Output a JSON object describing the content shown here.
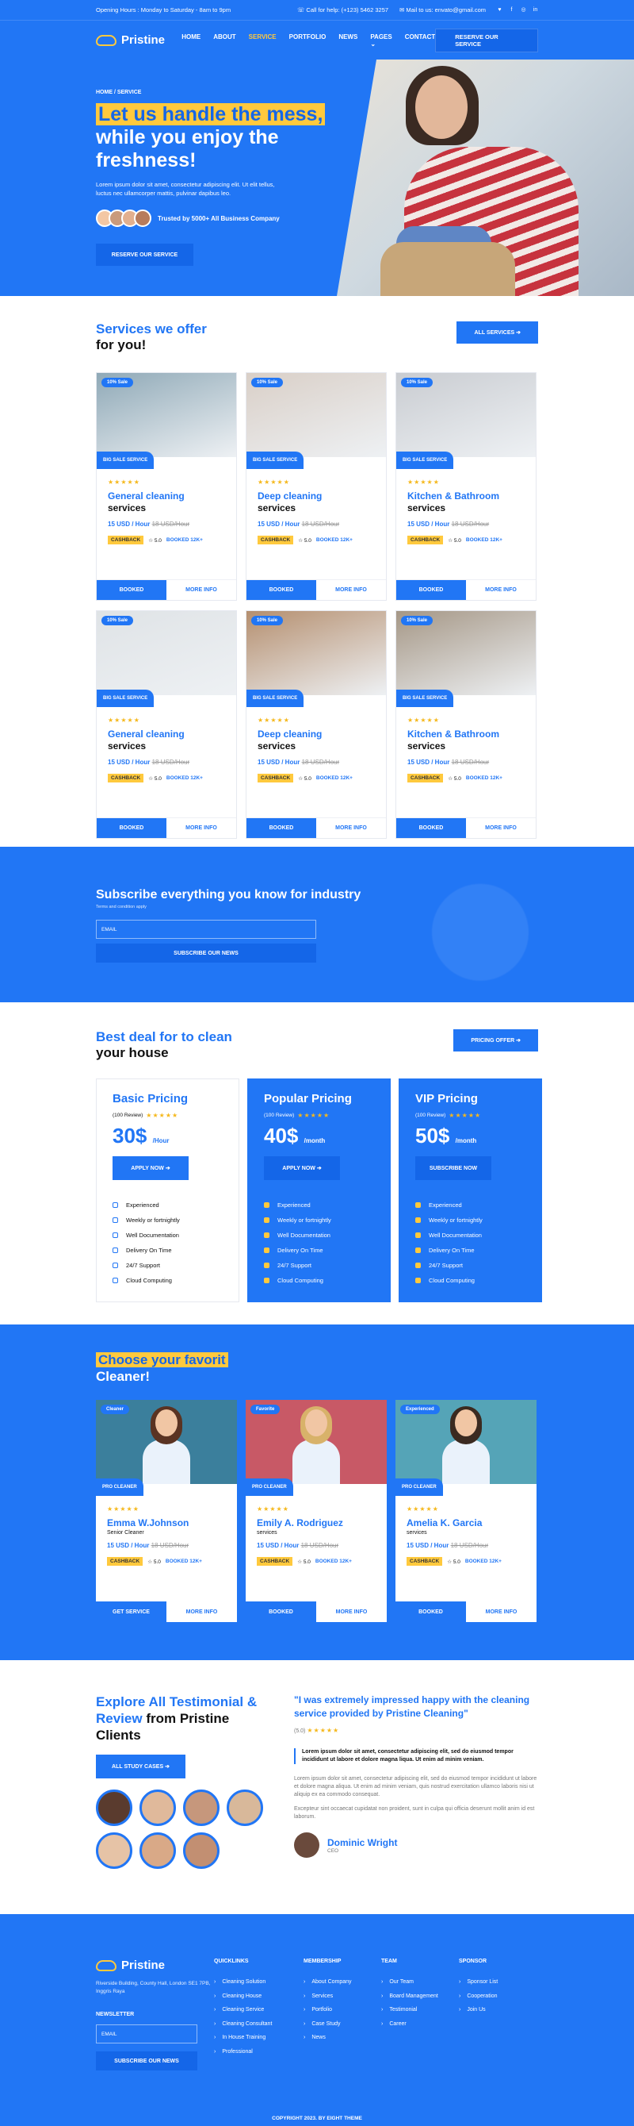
{
  "topbar": {
    "hours": "Opening Hours : Monday to Saturday - 8am to 9pm",
    "phone": "Call for help: (+123) 5462 3257",
    "mail": "Mail to us: envato@gmail.com"
  },
  "nav": {
    "brand": "Pristine",
    "items": [
      "HOME",
      "ABOUT",
      "SERVICE",
      "PORTFOLIO",
      "NEWS",
      "PAGES ⌄",
      "CONTACT"
    ],
    "cta": "RESERVE OUR SERVICE"
  },
  "hero": {
    "breadcrumb": "HOME / SERVICE",
    "title_hl": "Let us handle the mess,",
    "title_rest": "while you enjoy the freshness!",
    "desc": "Lorem ipsum dolor sit amet, consectetur adipiscing elit. Ut elit tellus, luctus nec ullamcorper mattis, pulvinar dapibus leo.",
    "trust": "Trusted by 5000+ All Business Company",
    "cta": "RESERVE OUR SERVICE"
  },
  "services": {
    "title_blue": "Services we offer",
    "title_rest": "for you!",
    "all": "ALL SERVICES ➔",
    "cards": [
      {
        "sale": "10% Sale",
        "tag": "BIG SALE SERVICE",
        "t1": "General cleaning",
        "t2": "services",
        "price": "15 USD / Hour",
        "old": "18 USD/Hour",
        "cash": "CASHBACK",
        "rate": "☆ 5.0",
        "booked": "BOOKED 12K+",
        "a1": "BOOKED",
        "a2": "MORE INFO",
        "bg": "#8fa9b7"
      },
      {
        "sale": "10% Sale",
        "tag": "BIG SALE SERVICE",
        "t1": "Deep cleaning",
        "t2": "services",
        "price": "15 USD / Hour",
        "old": "18 USD/Hour",
        "cash": "CASHBACK",
        "rate": "☆ 5.0",
        "booked": "BOOKED 12K+",
        "a1": "BOOKED",
        "a2": "MORE INFO",
        "bg": "#d9cfc7"
      },
      {
        "sale": "10% Sale",
        "tag": "BIG SALE SERVICE",
        "t1": "Kitchen & Bathroom",
        "t2": "services",
        "price": "15 USD / Hour",
        "old": "18 USD/Hour",
        "cash": "CASHBACK",
        "rate": "☆ 5.0",
        "booked": "BOOKED 12K+",
        "a1": "BOOKED",
        "a2": "MORE INFO",
        "bg": "#c9ccd1"
      },
      {
        "sale": "10% Sale",
        "tag": "BIG SALE SERVICE",
        "t1": "General cleaning",
        "t2": "services",
        "price": "15 USD / Hour",
        "old": "18 USD/Hour",
        "cash": "CASHBACK",
        "rate": "☆ 5.0",
        "booked": "BOOKED 12K+",
        "a1": "BOOKED",
        "a2": "MORE INFO",
        "bg": "#dfe3e6"
      },
      {
        "sale": "10% Sale",
        "tag": "BIG SALE SERVICE",
        "t1": "Deep cleaning",
        "t2": "services",
        "price": "15 USD / Hour",
        "old": "18 USD/Hour",
        "cash": "CASHBACK",
        "rate": "☆ 5.0",
        "booked": "BOOKED 12K+",
        "a1": "BOOKED",
        "a2": "MORE INFO",
        "bg": "#b58f6f"
      },
      {
        "sale": "10% Sale",
        "tag": "BIG SALE SERVICE",
        "t1": "Kitchen & Bathroom",
        "t2": "services",
        "price": "15 USD / Hour",
        "old": "18 USD/Hour",
        "cash": "CASHBACK",
        "rate": "☆ 5.0",
        "booked": "BOOKED 12K+",
        "a1": "BOOKED",
        "a2": "MORE INFO",
        "bg": "#a59786"
      }
    ]
  },
  "subscribe": {
    "title": "Subscribe everything you know for industry",
    "small": "Terms and condition apply",
    "email": "EMAIL",
    "btn": "SUBSCRIBE OUR NEWS"
  },
  "pricing": {
    "title_blue": "Best deal for to clean",
    "title_rest": "your house",
    "offer": "PRICING OFFER ➔",
    "plans": [
      {
        "name": "Basic Pricing",
        "reviews": "(100 Review)",
        "amt": "30$",
        "per": "/Hour",
        "btn": "APPLY NOW ➔",
        "dark": false
      },
      {
        "name": "Popular Pricing",
        "reviews": "(100 Review)",
        "amt": "40$",
        "per": "/month",
        "btn": "APPLY NOW ➔",
        "dark": true
      },
      {
        "name": "VIP Pricing",
        "reviews": "(100 Review)",
        "amt": "50$",
        "per": "/month",
        "btn": "SUBSCRIBE NOW",
        "dark": true
      }
    ],
    "features": [
      "Experienced",
      "Weekly or fortnightly",
      "Well Documentation",
      "Delivery On Time",
      "24/7 Support",
      "Cloud Computing"
    ]
  },
  "cleaners": {
    "title_hl": "Choose your favorit",
    "title_rest": "Cleaner!",
    "cards": [
      {
        "badge": "Cleaner",
        "name": "Emma W.Johnson",
        "role": "Senior Cleaner",
        "price": "15 USD / Hour",
        "old": "18 USD/Hour",
        "a1": "GET SERVICE",
        "a2": "MORE INFO",
        "bg": "#3b7f9c",
        "hair": "#5a3322"
      },
      {
        "badge": "Favorite",
        "name": "Emily A. Rodriguez",
        "role": "services",
        "price": "15 USD / Hour",
        "old": "18 USD/Hour",
        "a1": "BOOKED",
        "a2": "MORE INFO",
        "bg": "#c85966",
        "hair": "#d8b26a"
      },
      {
        "badge": "Experienced",
        "name": "Amelia K. Garcia",
        "role": "services",
        "price": "15 USD / Hour",
        "old": "18 USD/Hour",
        "a1": "BOOKED",
        "a2": "MORE INFO",
        "bg": "#55a4b7",
        "hair": "#3b2a20"
      }
    ],
    "tag": "PRO CLEANER",
    "cash": "CASHBACK",
    "rate": "☆ 5.0",
    "booked": "BOOKED 12K+"
  },
  "testimonial": {
    "title_blue": "Explore All Testimonial &",
    "title_blue2": "Review",
    "title_rest": " from Pristine Clients",
    "all": "ALL STUDY CASES ➔",
    "quote": "\"I was extremely impressed happy with the cleaning service provided by Pristine Cleaning\"",
    "rating": "(5.0)",
    "bold": "Lorem ipsum dolor sit amet, consectetur adipiscing elit, sed do eiusmod tempor incididunt ut labore et dolore magna liqua. Ut enim ad minim veniam.",
    "p1": "Lorem ipsum dolor sit amet, consectetur adipiscing elit, sed do eiusmod tempor incididunt ut labore et dolore magna aliqua. Ut enim ad minim veniam, quis nostrud exercitation ullamco laboris nisi ut aliquip ex ea commodo consequat.",
    "p2": "Excepteur sint occaecat cupidatat non proident, sunt in culpa qui officia deserunt mollit anim id est laborum.",
    "name": "Dominic Wright",
    "role": "CEO"
  },
  "footer": {
    "brand": "Pristine",
    "addr": "Riverside Building, County Hall, London SE1 7PB, Inggris Raya",
    "newsletter": "NEWSLETTER",
    "email": "EMAIL",
    "btn": "SUBSCRIBE OUR NEWS",
    "cols": [
      {
        "h": "QUICKLINKS",
        "items": [
          "Cleaning Solution",
          "Cleaning House",
          "Cleaning Service",
          "Cleaning Consultant",
          "In House Training",
          "Professional"
        ]
      },
      {
        "h": "MEMBERSHIP",
        "items": [
          "About Company",
          "Services",
          "Portfolio",
          "Case Study",
          "News"
        ]
      },
      {
        "h": "TEAM",
        "items": [
          "Our Team",
          "Board Management",
          "Testimonial",
          "Career"
        ]
      },
      {
        "h": "SPONSOR",
        "items": [
          "Sponsor List",
          "Cooperation",
          "Join Us"
        ]
      }
    ],
    "copy": "COPYRIGHT 2023. BY EIGHT THEME"
  }
}
